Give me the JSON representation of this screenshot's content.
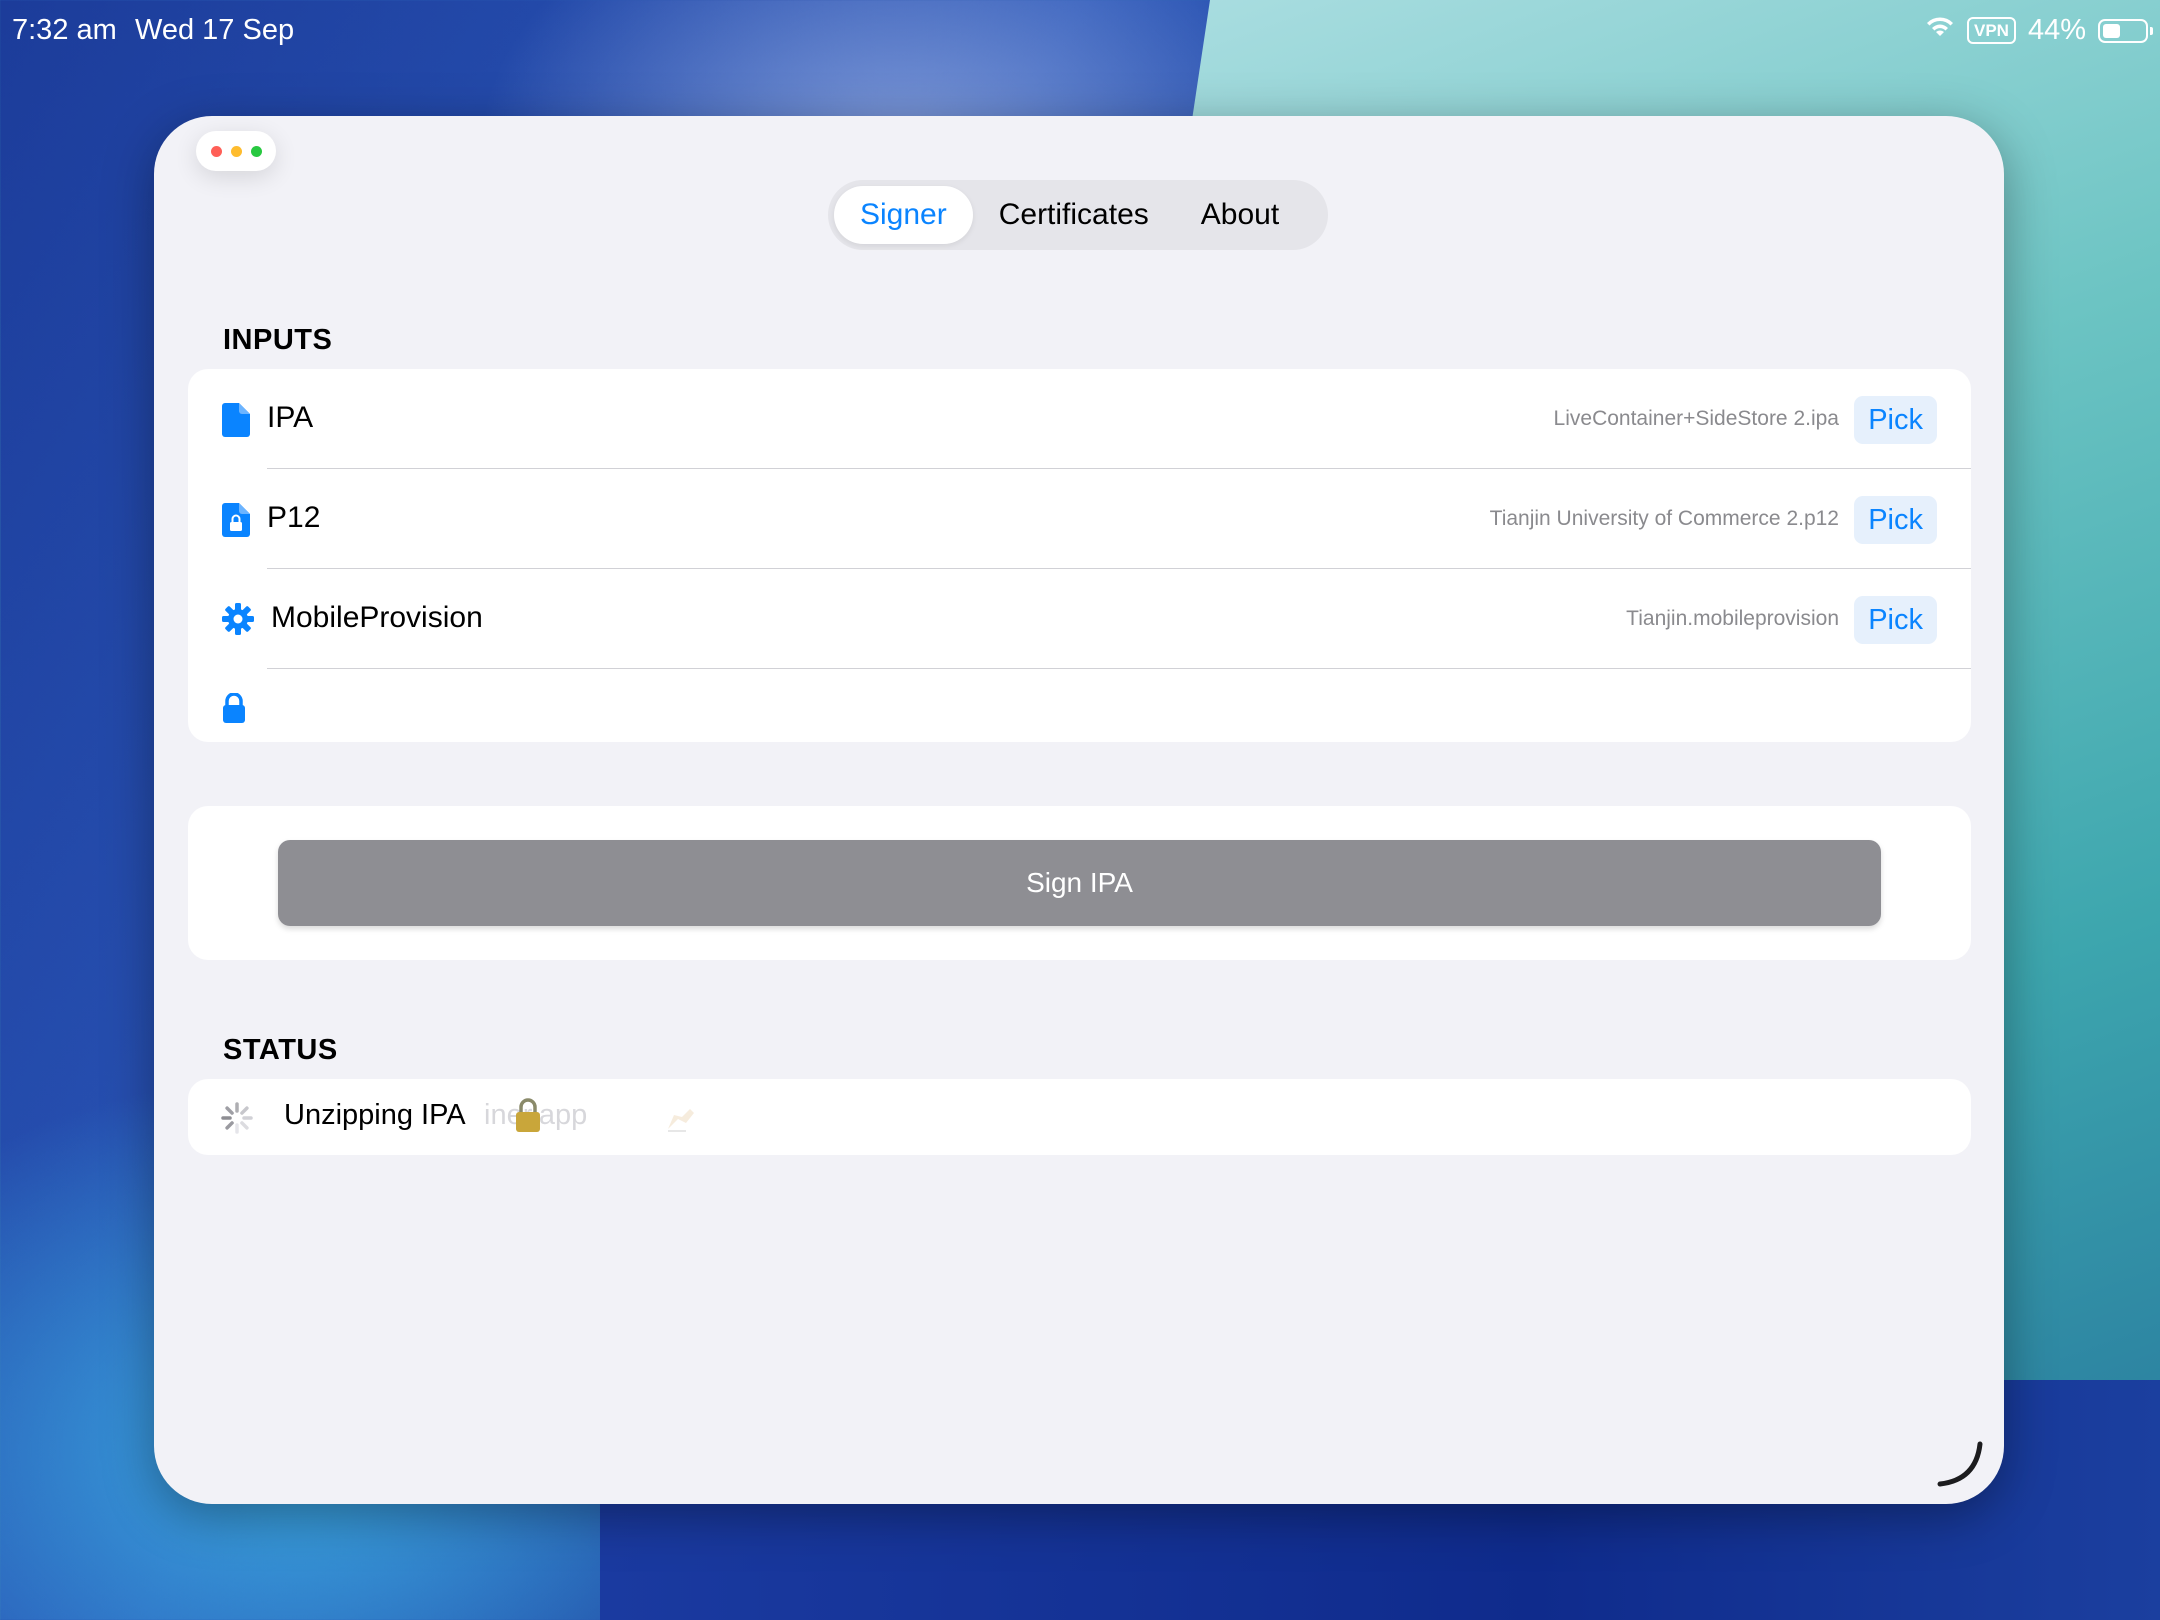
{
  "status_bar": {
    "time": "7:32 am",
    "date": "Wed 17 Sep",
    "vpn": "VPN",
    "battery_percent": "44%",
    "battery_level": 0.44
  },
  "tabs": [
    {
      "label": "Signer",
      "active": true
    },
    {
      "label": "Certificates",
      "active": false
    },
    {
      "label": "About",
      "active": false
    }
  ],
  "inputs": {
    "header": "INPUTS",
    "rows": [
      {
        "icon": "document-icon",
        "label": "IPA",
        "value": "LiveContainer+SideStore 2.ipa",
        "action": "Pick"
      },
      {
        "icon": "document-lock-icon",
        "label": "P12",
        "value": "Tianjin University of Commerce 2.p12",
        "action": "Pick"
      },
      {
        "icon": "gear-icon",
        "label": "MobileProvision",
        "value": "Tianjin.mobileprovision",
        "action": "Pick"
      }
    ],
    "password_row": {
      "icon": "lock-icon",
      "value": ""
    }
  },
  "sign_button": "Sign IPA",
  "status": {
    "header": "STATUS",
    "message": "Unzipping IPA",
    "ghost_message": "iner.app"
  },
  "colors": {
    "accent": "#0a84ff",
    "window_bg": "#f2f2f7",
    "disabled_button": "#8e8e93",
    "close_dot": "#ff5f57",
    "minimize_dot": "#febc2e",
    "zoom_dot": "#28c840"
  }
}
